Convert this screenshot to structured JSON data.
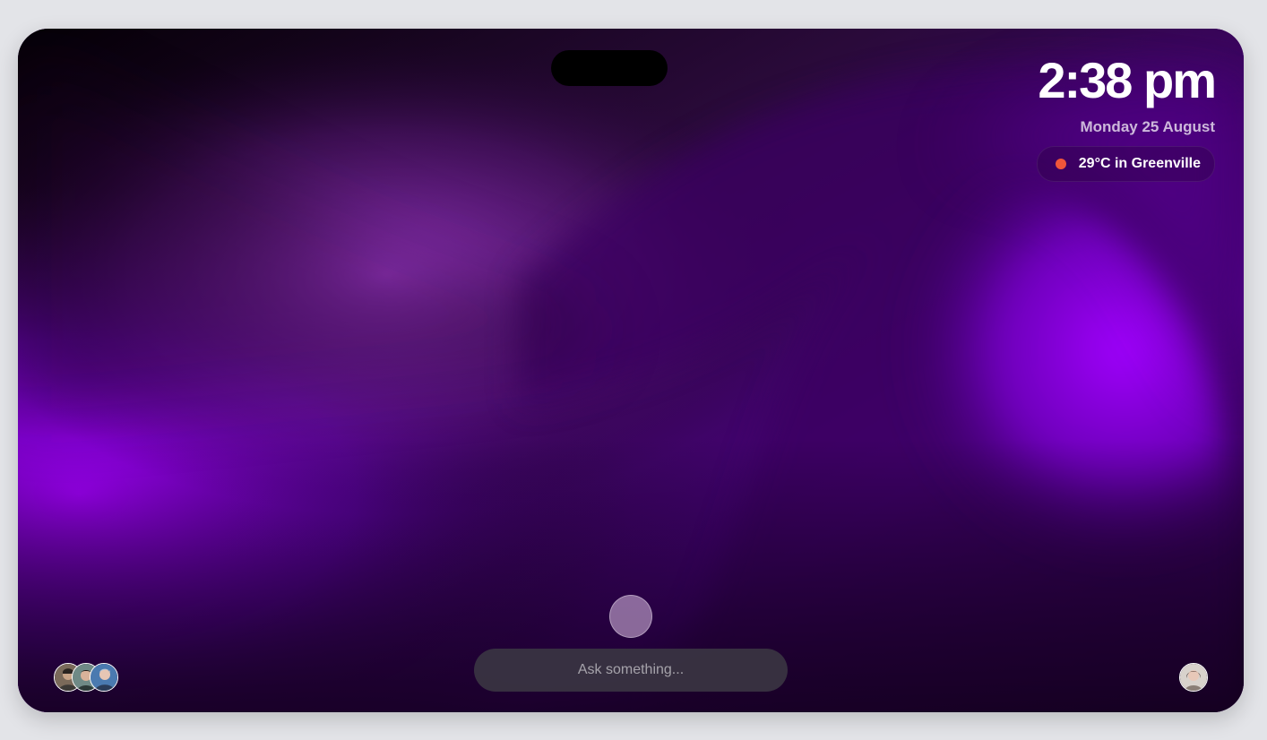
{
  "clock": {
    "time": "2:38 pm",
    "date": "Monday 25 August"
  },
  "weather": {
    "text": "29°C in Greenville",
    "status_color": "#f0563a"
  },
  "assistant": {
    "placeholder": "Ask something..."
  },
  "contacts": [
    {
      "icon": "contact-avatar-1"
    },
    {
      "icon": "contact-avatar-2"
    },
    {
      "icon": "contact-avatar-3"
    }
  ],
  "user": {
    "icon": "user-avatar"
  },
  "theme": {
    "accent": "#a000ff",
    "background": "#e3e4e8"
  }
}
